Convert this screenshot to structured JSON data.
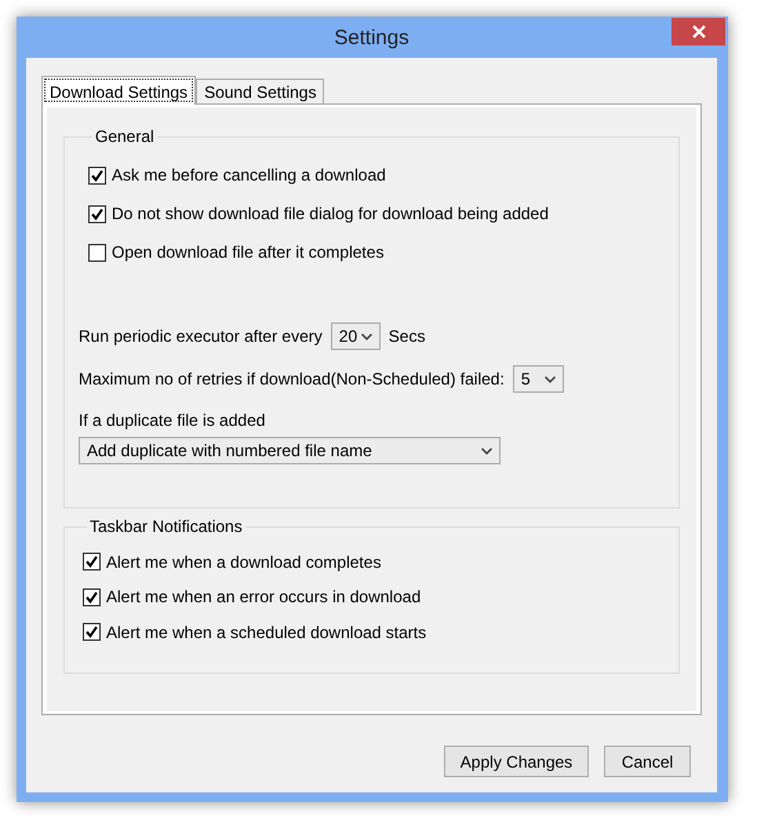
{
  "window": {
    "title": "Settings"
  },
  "tabs": [
    {
      "label": "Download Settings",
      "selected": true
    },
    {
      "label": "Sound Settings",
      "selected": false
    }
  ],
  "general": {
    "title": "General",
    "checkboxes": [
      {
        "label": "Ask me before cancelling a download",
        "checked": true
      },
      {
        "label": "Do not show download file dialog for download being added",
        "checked": true
      },
      {
        "label": "Open download file after it completes",
        "checked": false
      }
    ],
    "executor": {
      "label": "Run periodic executor after every",
      "value": "20",
      "unit": "Secs"
    },
    "retries": {
      "label": "Maximum no of retries if download(Non-Scheduled) failed:",
      "value": "5"
    },
    "duplicate": {
      "label": "If a duplicate file is added",
      "value": "Add duplicate with numbered file name"
    }
  },
  "notifications": {
    "title": "Taskbar Notifications",
    "checkboxes": [
      {
        "label": "Alert me when a download completes",
        "checked": true
      },
      {
        "label": "Alert me when an error occurs in download",
        "checked": true
      },
      {
        "label": "Alert me when a scheduled download starts",
        "checked": true
      }
    ]
  },
  "buttons": [
    "Apply Changes",
    "Cancel"
  ]
}
